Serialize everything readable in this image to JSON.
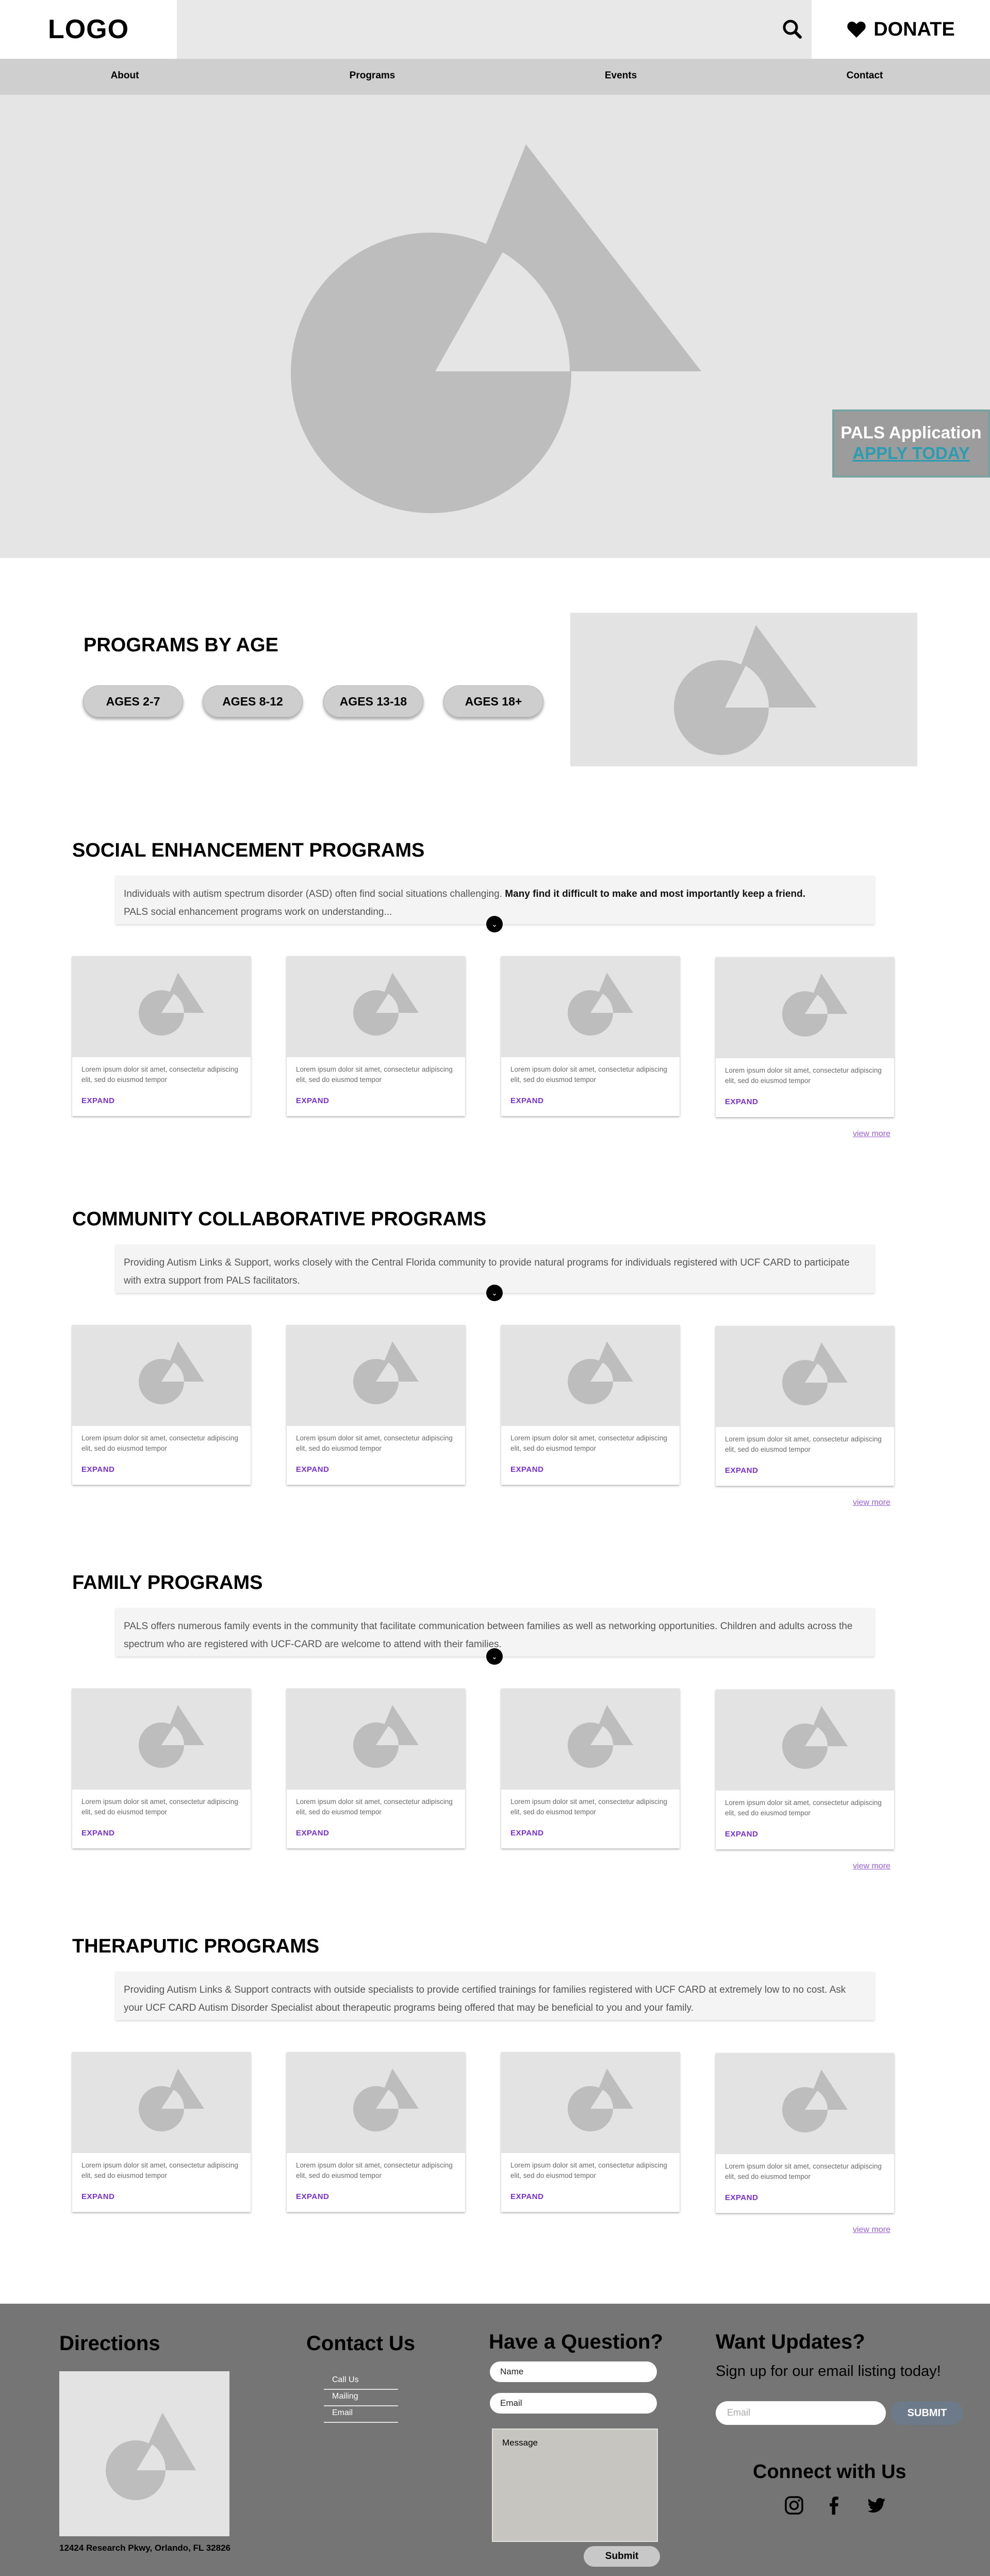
{
  "header": {
    "logo": "LOGO",
    "donate_label": "DONATE",
    "nav": [
      {
        "label": "About"
      },
      {
        "label": "Programs"
      },
      {
        "label": "Events"
      },
      {
        "label": "Contact"
      }
    ]
  },
  "hero": {
    "pals_title": "PALS Application",
    "pals_link": "APPLY TODAY"
  },
  "programs_by_age": {
    "title": "PROGRAMS BY AGE",
    "ages": [
      "AGES 2-7",
      "AGES 8-12",
      "AGES 13-18",
      "AGES 18+"
    ]
  },
  "card_text": "Lorem ipsum dolor sit amet, consectetur adipiscing elit, sed do eiusmod tempor",
  "card_expand": "EXPAND",
  "view_more": "view more",
  "sections": [
    {
      "title": "SOCIAL ENHANCEMENT PROGRAMS",
      "desc_a": "Individuals with autism spectrum disorder (ASD) often find social situations challenging. ",
      "desc_b": "Many find it difficult to make and most importantly keep a friend.",
      "desc_c": "PALS social enhancement programs work on understanding..."
    },
    {
      "title": "COMMUNITY COLLABORATIVE PROGRAMS",
      "desc_a": "Providing Autism Links & Support, works closely with the Central Florida community to provide natural programs for individuals registered with UCF CARD to participate with extra support from PALS facilitators."
    },
    {
      "title": "FAMILY PROGRAMS",
      "desc_a": "PALS offers numerous family events in the community that facilitate communication between families as well as networking opportunities. Children and adults across the spectrum who are registered with UCF-CARD are welcome to attend with their families."
    },
    {
      "title": "THERAPUTIC PROGRAMS",
      "desc_a": "Providing Autism Links & Support contracts with outside specialists to provide certified trainings for families registered with UCF CARD at extremely low to no cost. Ask your UCF CARD Autism Disorder Specialist about therapeutic programs being offered that may be beneficial to you and your family."
    }
  ],
  "footer": {
    "directions_title": "Directions",
    "address": "12424 Research Pkwy, Orlando, FL 32826",
    "contact_title": "Contact Us",
    "contact_links": [
      "Call Us",
      "Mailing",
      "Email"
    ],
    "question_title": "Have a Question?",
    "name_placeholder": "Name",
    "email_placeholder": "Email",
    "message_placeholder": "Message",
    "submit_label": "Submit",
    "updates_title": "Want Updates?",
    "updates_sub": "Sign up for our email listing today!",
    "updates_email_placeholder": "Email",
    "updates_submit": "SUBMIT",
    "connect_title": "Connect with Us"
  }
}
